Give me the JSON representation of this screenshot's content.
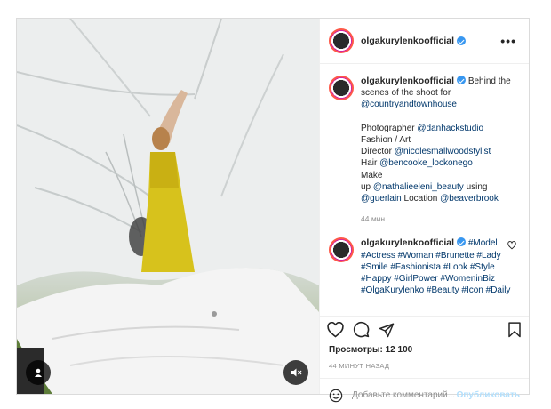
{
  "post": {
    "username": "olgakurylenkoofficial",
    "more_icon": "more-dots-icon"
  },
  "caption": {
    "username": "olgakurylenkoofficial",
    "text_1": "Behind the scenes of the shoot for ",
    "mention_1": "@countryandtownhouse",
    "line_photographer": "Photographer ",
    "mention_photographer": "@danhackstudio",
    "line_fashion": "Fashion / Art",
    "line_director": "Director ",
    "mention_director": "@nicolesmallwoodstylist",
    "line_hair": "Hair ",
    "mention_hair": "@bencooke_lockonego",
    "line_make": "Make",
    "line_up": "up ",
    "mention_makeup": "@nathalieeleni_beauty",
    "line_using": " using ",
    "mention_brand": "@guerlain",
    "line_location": " Location ",
    "mention_location": "@beaverbrook",
    "time": "44 мин."
  },
  "comment": {
    "username": "olgakurylenkoofficial",
    "hashtags": "#Model #Actress #Woman #Brunette #Lady #Smile #Fashionista #Look #Style #Happy #GirlPower #WomeninBiz #OlgaKurylenko #Beauty #Icon #Daily"
  },
  "stats": {
    "views_label": "Просмотры: ",
    "views_count": "12 100",
    "posted_ago": "44 МИНУТ НАЗАД"
  },
  "composer": {
    "placeholder": "Добавьте комментарий...",
    "post_label": "Опубликовать"
  },
  "colors": {
    "link": "#00376b",
    "verified": "#3897f0",
    "post_button_disabled": "#b2dffc"
  }
}
